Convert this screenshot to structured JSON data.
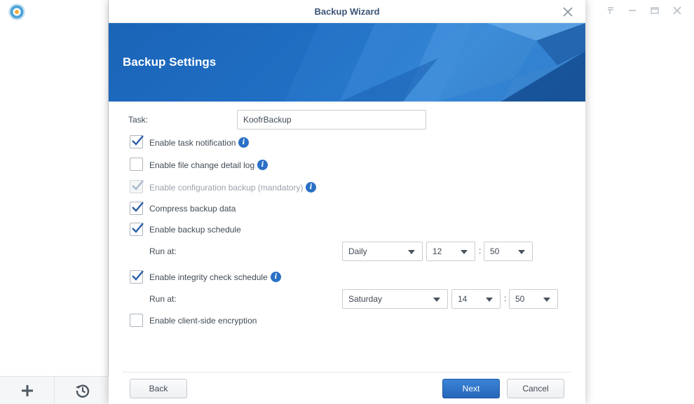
{
  "app": {
    "logo_icon": "app-logo-icon",
    "window_controls": [
      "pin-icon",
      "minimize-icon",
      "maximize-icon",
      "close-icon"
    ],
    "bottom_buttons": [
      "add-icon",
      "history-icon"
    ]
  },
  "modal": {
    "title": "Backup Wizard",
    "banner_title": "Backup Settings",
    "accent_color": "#1f6fc4"
  },
  "form": {
    "task_label": "Task:",
    "task_value": "KoofrBackup",
    "options": {
      "task_notification": {
        "label": "Enable task notification",
        "checked": true,
        "has_info": true
      },
      "file_change_log": {
        "label": "Enable file change detail log",
        "checked": false,
        "has_info": true
      },
      "config_backup": {
        "label": "Enable configuration backup (mandatory)",
        "checked": true,
        "disabled": true,
        "has_info": true
      },
      "compress": {
        "label": "Compress backup data",
        "checked": true
      },
      "backup_schedule": {
        "label": "Enable backup schedule",
        "checked": true
      },
      "integrity_schedule": {
        "label": "Enable integrity check schedule",
        "checked": true,
        "has_info": true
      },
      "encryption": {
        "label": "Enable client-side encryption",
        "checked": false
      }
    },
    "backup_schedule_run": {
      "label": "Run at:",
      "frequency": "Daily",
      "hour": "12",
      "minute": "50",
      "separator": ":"
    },
    "integrity_schedule_run": {
      "label": "Run at:",
      "frequency": "Saturday",
      "hour": "14",
      "minute": "50",
      "separator": ":"
    }
  },
  "footer": {
    "back": "Back",
    "next": "Next",
    "cancel": "Cancel"
  }
}
